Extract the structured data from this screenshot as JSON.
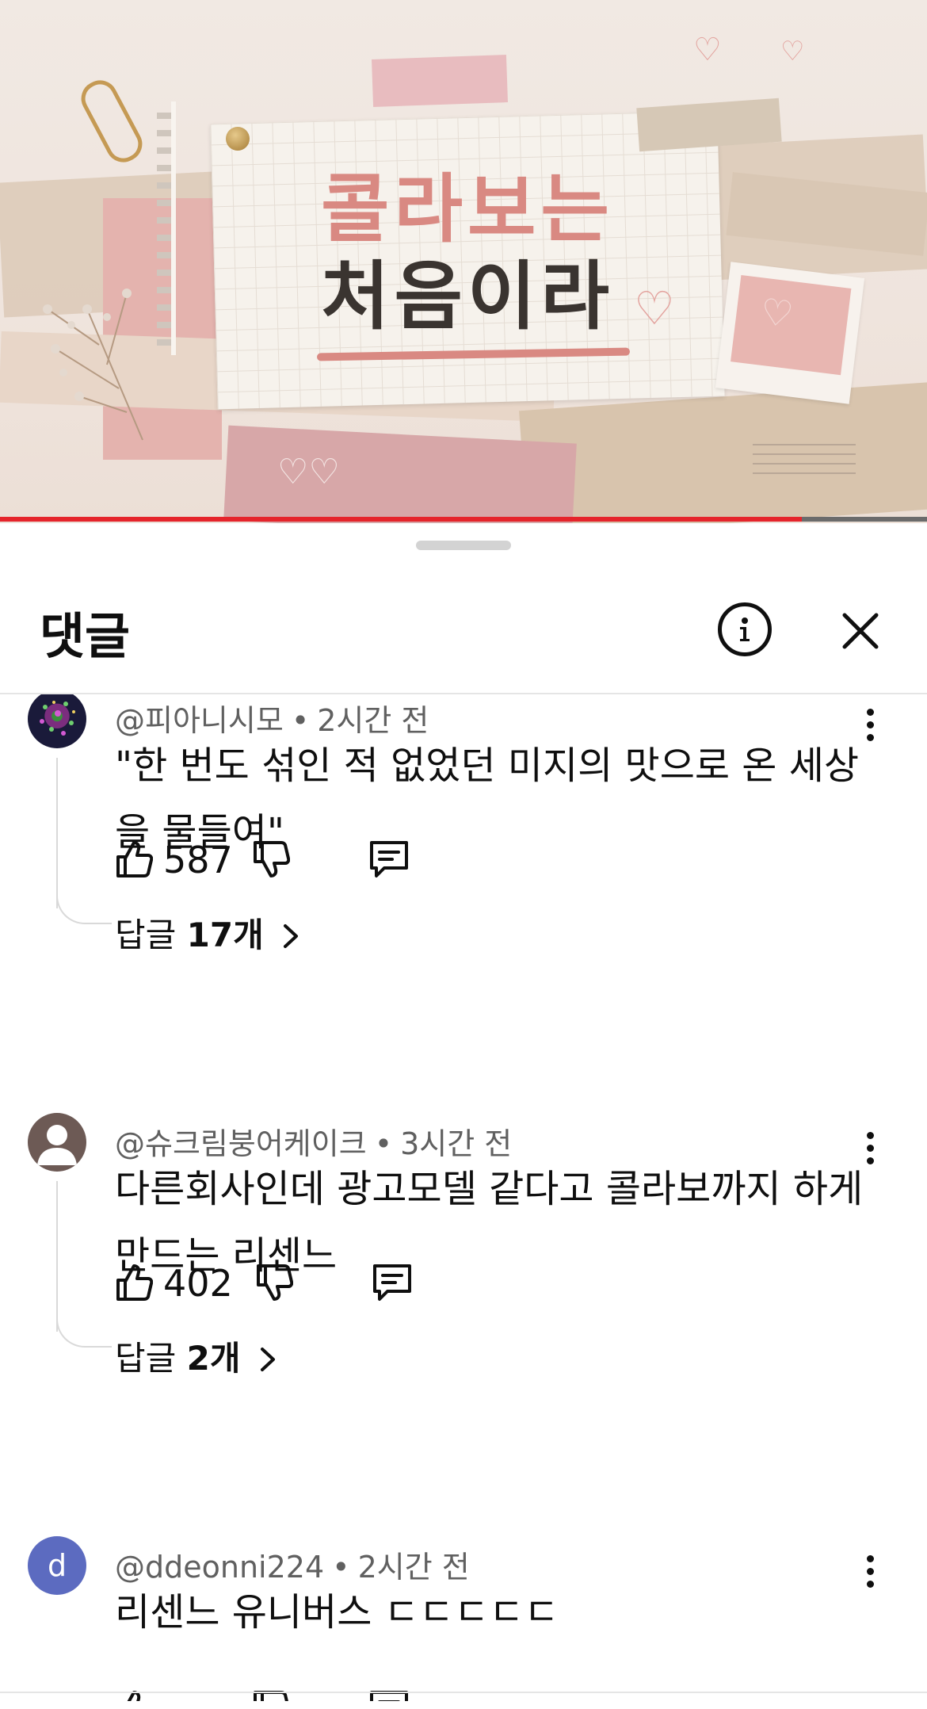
{
  "video": {
    "title_line1": "콜라보는",
    "title_line2": "처음이라",
    "progress_fraction": 0.865,
    "colors": {
      "progress": "#e5242b",
      "title_pink": "#d98982",
      "title_dark": "#3a3430"
    }
  },
  "sheet": {
    "title": "댓글",
    "info_icon": "info-icon",
    "close_icon": "close-icon"
  },
  "comments": [
    {
      "author": "@피아니시모",
      "time": "2시간 전",
      "text": "\"한 번도 섞인 적 없었던 미지의 맛으로 온 세상을 물들여\"",
      "likes": "587",
      "replies_label": "답글",
      "replies_count": "17개",
      "avatar": "photo-avatar"
    },
    {
      "author": "@슈크림붕어케이크",
      "time": "3시간 전",
      "text": "다른회사인데 광고모델 같다고 콜라보까지 하게 만드는 리센느",
      "likes": "402",
      "replies_label": "답글",
      "replies_count": "2개",
      "avatar": "default-person-avatar"
    },
    {
      "author": "@ddeonni224",
      "time": "2시간 전",
      "text": "리센느 유니버스 ㄷㄷㄷㄷㄷ",
      "avatar_letter": "d",
      "avatar_color": "#5c6bc0"
    }
  ]
}
